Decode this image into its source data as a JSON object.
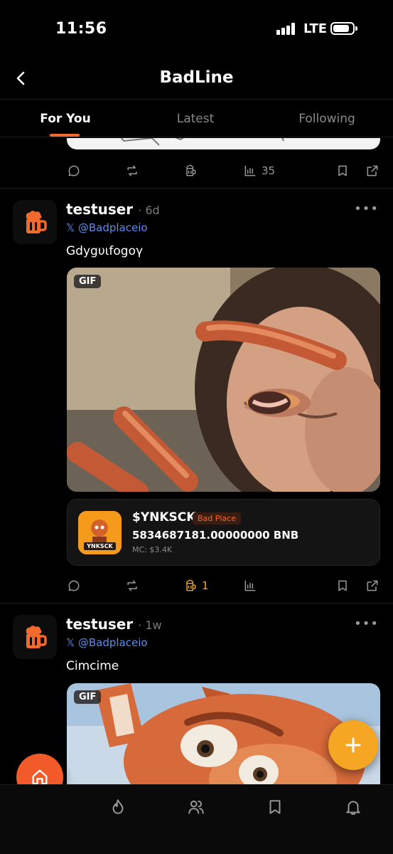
{
  "status_bar": {
    "time": "11:56",
    "network": "LTE"
  },
  "header": {
    "title": "BadLine"
  },
  "tabs": [
    {
      "label": "For You",
      "active": true
    },
    {
      "label": "Latest",
      "active": false
    },
    {
      "label": "Following",
      "active": false
    }
  ],
  "previous_post": {
    "views": "35"
  },
  "posts": [
    {
      "username": "testuser",
      "time": "· 6d",
      "handle": "@Badplaceio",
      "text": "Gdygυιfogoγ",
      "media_badge": "GIF",
      "likes": "1",
      "token": {
        "ticker": "$YNKSCK",
        "tag": "Bad Place",
        "amount": "5834687181.00000000 BNB",
        "market_cap": "MC: $3.4K",
        "logo_text": "YNKSCK"
      }
    },
    {
      "username": "testuser",
      "time": "· 1w",
      "handle": "@Badplaceio",
      "text": "Cimcime",
      "media_badge": "GIF"
    }
  ],
  "colors": {
    "accent": "#f26a2e",
    "fab": "#f5a623",
    "link": "#5b8dee"
  },
  "icons": {
    "post_actions": [
      "comment-icon",
      "repost-icon",
      "beer-icon",
      "views-icon",
      "bookmark-icon",
      "share-icon"
    ],
    "bottom_nav": [
      "home-icon",
      "fire-icon",
      "users-icon",
      "bookmark-icon",
      "bell-icon"
    ],
    "fab": "plus-icon"
  }
}
